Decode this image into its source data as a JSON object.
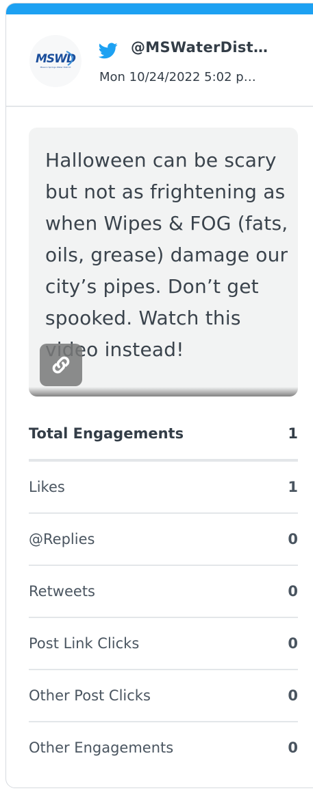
{
  "header": {
    "avatar_logo_text": "MSWD",
    "avatar_logo_subtext": "Mission Springs Water District",
    "handle": "@MSWaterDist…",
    "timestamp": "Mon 10/24/2022 5:02 p…"
  },
  "post": {
    "text": "Halloween can be scary but not as frightening as when Wipes & FOG (fats, oils, grease) damage our city’s pipes. Don’t get spooked. Watch this video instead!",
    "link_icon": "link-icon"
  },
  "stats": {
    "total": {
      "label": "Total Engagements",
      "value": "1"
    },
    "rows": [
      {
        "label": "Likes",
        "value": "1"
      },
      {
        "label": "@Replies",
        "value": "0"
      },
      {
        "label": "Retweets",
        "value": "0"
      },
      {
        "label": "Post Link Clicks",
        "value": "0"
      },
      {
        "label": "Other Post Clicks",
        "value": "0"
      },
      {
        "label": "Other Engagements",
        "value": "0"
      }
    ]
  },
  "colors": {
    "accent": "#1da1f2",
    "post_background": "#f2f3f3",
    "text": "#333d47",
    "divider": "#e3e6e9"
  }
}
